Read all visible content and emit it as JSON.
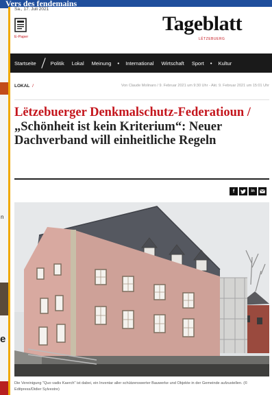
{
  "background": {
    "top_strip_text": "Vers des fendemains",
    "frag_1": "n",
    "frag_2": "e"
  },
  "header": {
    "date": "Sa., 17. Juli 2021",
    "epaper_label": "E-Paper",
    "logo": "Tageblatt",
    "logo_sub": "LËTZEBUERG"
  },
  "nav": {
    "items": [
      "Startseite",
      "Politik",
      "Lokal",
      "Meinung",
      "International",
      "Wirtschaft",
      "Sport",
      "Kultur"
    ]
  },
  "article": {
    "section": "LOKAL",
    "section_sep": "/",
    "byline": "Von Claude Molinaro / 9. Februar 2021 um 9:30 Uhr - Akt. 9. Februar 2021 um 15:01 Uhr",
    "kicker": "Lëtzebuerger Denkmalschutz-Federatioun /",
    "title": "„Schönheit ist kein Kriterium“: Neuer Dachverband will einheitliche Regeln",
    "share": [
      "f",
      "t",
      "in",
      "mail"
    ],
    "caption": "Die Vereinigung \"Quo vadis Kaerch\" ist dabei, ein Inventar aller schützenswerter Bauwerke und Objekte in der Gemeinde aufzustellen. (© Editpress/Didier Sylvestre)"
  },
  "colors": {
    "accent_red": "#c4151c",
    "nav_bg": "#1a1a1a",
    "window_border": "#f0a800",
    "top_strip": "#1f4e9c"
  },
  "icons": {
    "epaper": "newspaper-icon",
    "facebook": "facebook-icon",
    "twitter": "twitter-icon",
    "linkedin": "linkedin-icon",
    "email": "mail-icon"
  }
}
